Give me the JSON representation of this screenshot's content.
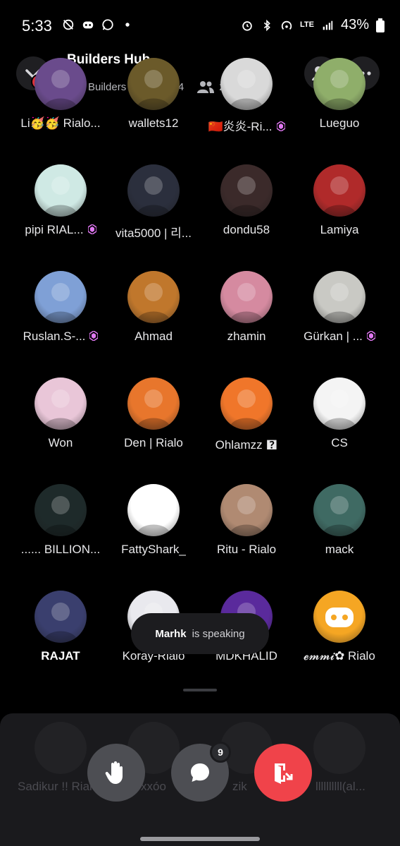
{
  "status_bar": {
    "time": "5:33",
    "network": "LTE",
    "battery": "43%",
    "left_icons": [
      "eye-off-icon",
      "discord-icon",
      "whatsapp-icon",
      "dot-icon"
    ],
    "right_icons": [
      "alarm-icon",
      "bluetooth-icon",
      "hotspot-icon",
      "lte-icon",
      "signal-icon",
      "battery-icon"
    ]
  },
  "header": {
    "title": "Builders Hub",
    "back_badge": "6k",
    "stage_name": "Builders Hub",
    "speaker_count": "4",
    "listener_count": "228"
  },
  "participants": [
    {
      "name": "Li🥳🥳 Rialo...",
      "boost": false,
      "bold": false,
      "color": "#6a4b8c"
    },
    {
      "name": "wallets12",
      "boost": false,
      "bold": false,
      "color": "#6b5a2a"
    },
    {
      "name": "🇨🇳炎炎-Ri...",
      "boost": true,
      "bold": false,
      "color": "#d9d9d9"
    },
    {
      "name": "Lueguo",
      "boost": false,
      "bold": false,
      "color": "#8fae6a"
    },
    {
      "name": "pipi  RIAL...",
      "boost": true,
      "bold": false,
      "color": "#cfe9e4"
    },
    {
      "name": "vita5000 | 리...",
      "boost": false,
      "bold": false,
      "color": "#2b2f3d"
    },
    {
      "name": "dondu58",
      "boost": false,
      "bold": false,
      "color": "#3b2a2a"
    },
    {
      "name": "Lamiya",
      "boost": false,
      "bold": false,
      "color": "#b02a2a"
    },
    {
      "name": "Ruslan.S-...",
      "boost": true,
      "bold": false,
      "color": "#7fa0d6"
    },
    {
      "name": "Ahmad",
      "boost": false,
      "bold": false,
      "color": "#c0772c"
    },
    {
      "name": "zhamin",
      "boost": false,
      "bold": false,
      "color": "#d58aa0"
    },
    {
      "name": "Gürkan | ...",
      "boost": true,
      "bold": false,
      "color": "#c9c9c4"
    },
    {
      "name": "Won",
      "boost": false,
      "bold": false,
      "color": "#e9c6d8"
    },
    {
      "name": "Den | Rialo",
      "boost": false,
      "bold": false,
      "color": "#e8762c"
    },
    {
      "name": "Ohlamzz 🯄",
      "boost": false,
      "bold": false,
      "color": "#f0762a"
    },
    {
      "name": "CS",
      "boost": false,
      "bold": false,
      "color": "#f4f4f4"
    },
    {
      "name": "...... BILLION...",
      "boost": false,
      "bold": false,
      "color": "#1e2a2a"
    },
    {
      "name": "FattyShark_",
      "boost": false,
      "bold": false,
      "color": "#ffffff"
    },
    {
      "name": "Ritu - Rialo",
      "boost": false,
      "bold": false,
      "color": "#b08a72"
    },
    {
      "name": "mack",
      "boost": false,
      "bold": false,
      "color": "#3f6a63"
    },
    {
      "name": "RAJAT",
      "boost": false,
      "bold": true,
      "color": "#3a3f6e"
    },
    {
      "name": "Koray-Rialo",
      "boost": false,
      "bold": false,
      "color": "#e9e9ee"
    },
    {
      "name": "MDKHALID",
      "boost": false,
      "bold": false,
      "color": "#5a2a9c"
    },
    {
      "name": "𝓮𝓶𝓶𝓲✿ Rialo",
      "boost": false,
      "bold": false,
      "color": "#f5a623"
    }
  ],
  "speaking_toast": {
    "user": "Marhk",
    "text": "is speaking"
  },
  "bottom_panel": {
    "ghost_names": [
      "Sadikur !! Rialo",
      "xxóo",
      "zik",
      "llllllllll(al..."
    ],
    "chat_badge": "9"
  },
  "colors": {
    "boost": "#e078f2",
    "leave": "#f0434a",
    "discord_blurple": "#f5a623"
  }
}
